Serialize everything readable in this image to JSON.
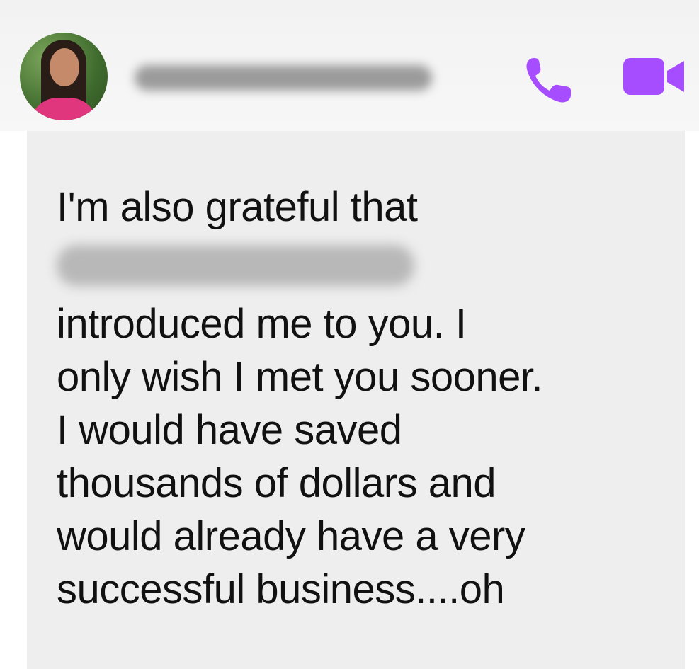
{
  "header": {
    "avatar_icon": "contact-avatar",
    "call_icon": "phone-icon",
    "video_icon": "video-camera-icon",
    "accent_color": "#a64dff"
  },
  "message": {
    "lines": [
      "I'm also grateful that",
      "introduced me to you. I",
      "only wish I met you sooner.",
      "I would have saved",
      "thousands of dollars and",
      "would already have a very",
      "successful business....oh"
    ]
  }
}
